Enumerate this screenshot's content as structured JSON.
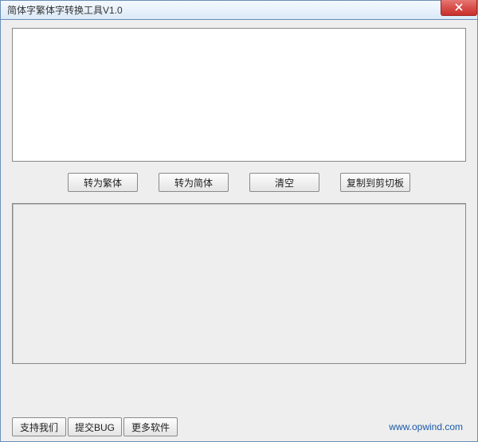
{
  "window": {
    "title": "简体字繁体字转换工具V1.0"
  },
  "input": {
    "value": "",
    "placeholder": ""
  },
  "output": {
    "value": "",
    "placeholder": ""
  },
  "actions": {
    "to_traditional": "转为繁体",
    "to_simplified": "转为简体",
    "clear": "清空",
    "copy_clipboard": "复制到剪切板"
  },
  "bottom": {
    "support_us": "支持我们",
    "submit_bug": "提交BUG",
    "more_software": "更多软件"
  },
  "footer": {
    "link_text": "www.opwind.com"
  }
}
